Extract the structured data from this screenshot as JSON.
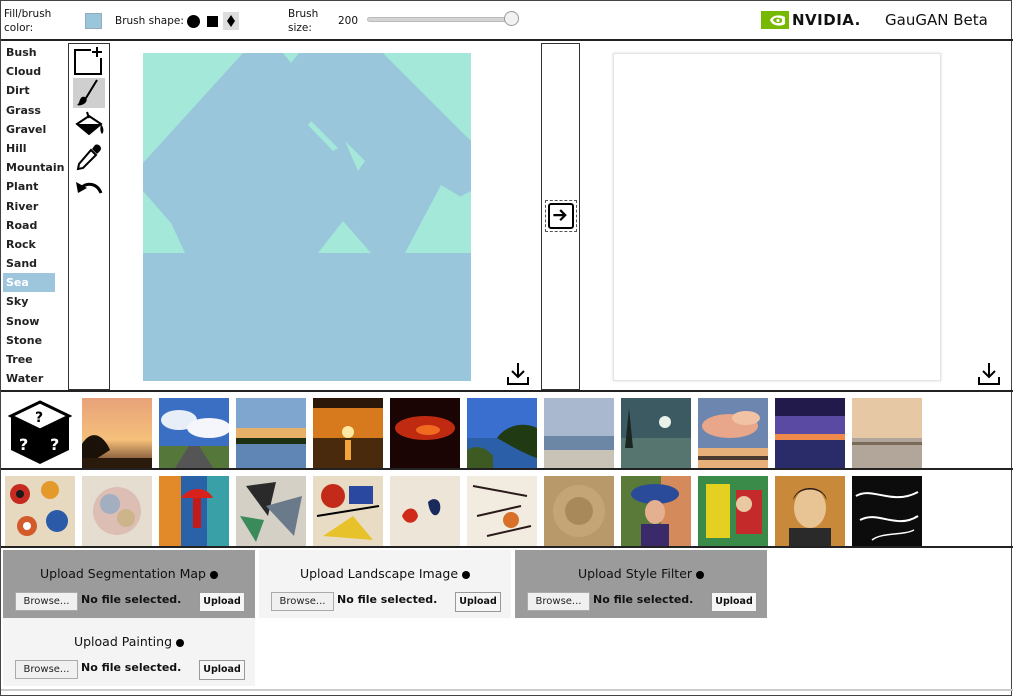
{
  "toolbar": {
    "fill_label_1": "Fill/brush",
    "fill_label_2": "color:",
    "fill_color": "#9ac6dc",
    "brush_shape_label": "Brush shape:",
    "brush_size_label_1": "Brush",
    "brush_size_label_2": "size:",
    "brush_size_value": "200",
    "brush_size_fraction": 0.99,
    "brand": "NVIDIA.",
    "app_title": "GauGAN Beta"
  },
  "labels": [
    "Bush",
    "Cloud",
    "Dirt",
    "Grass",
    "Gravel",
    "Hill",
    "Mountain",
    "Plant",
    "River",
    "Road",
    "Rock",
    "Sand",
    "Sea",
    "Sky",
    "Snow",
    "Stone",
    "Tree",
    "Water"
  ],
  "selected_label": "Sea",
  "tools": [
    "new-canvas-icon",
    "brush-icon",
    "fill-bucket-icon",
    "eyedropper-icon",
    "undo-icon"
  ],
  "colors": {
    "sea": "#9ac6dc",
    "background": "#a3e8d9"
  },
  "uploads": {
    "segmentation": {
      "title": "Upload Segmentation Map",
      "browse": "Browse...",
      "status": "No file selected.",
      "button": "Upload"
    },
    "landscape": {
      "title": "Upload Landscape Image",
      "browse": "Browse...",
      "status": "No file selected.",
      "button": "Upload"
    },
    "style": {
      "title": "Upload Style Filter",
      "browse": "Browse...",
      "status": "No file selected.",
      "button": "Upload"
    },
    "painting": {
      "title": "Upload Painting",
      "browse": "Browse...",
      "status": "No file selected.",
      "button": "Upload"
    }
  }
}
